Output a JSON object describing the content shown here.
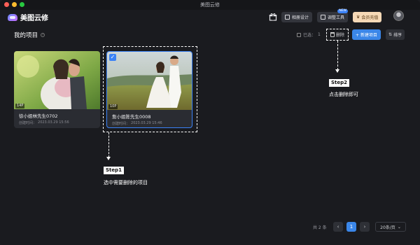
{
  "window": {
    "title": "美图云修"
  },
  "app": {
    "name": "美图云修"
  },
  "toolbar": {
    "album_design": "相册设计",
    "retouch_tools": "调整工具",
    "new_badge": "NEW",
    "vip": "会员充值"
  },
  "main": {
    "section_title": "我的项目",
    "help": "?",
    "selected_label": "已选：",
    "selected_count": "1",
    "delete_label": "删除",
    "new_project": "+ 新建项目",
    "sort_label": "排序"
  },
  "projects": [
    {
      "name": "徐小姐林先生0702",
      "photos": "14P",
      "created_label": "创建时间：",
      "created": "2023.03.29 15:56",
      "selected": false
    },
    {
      "name": "詹小姐陈先生0008",
      "photos": "10P",
      "created_label": "创建时间：",
      "created": "2023.03.29 15:46",
      "selected": true
    }
  ],
  "steps": [
    {
      "label": "Step1",
      "desc": "选中需要删除的项目"
    },
    {
      "label": "Step2",
      "desc": "点击删除即可"
    }
  ],
  "pagination": {
    "total": "共 2 条",
    "prev": "‹",
    "current": "1",
    "next": "›",
    "per_page": "20条/页"
  },
  "colors": {
    "accent": "#3a86e8",
    "background": "#1a1b1f",
    "vip": "#f6d9b7"
  }
}
